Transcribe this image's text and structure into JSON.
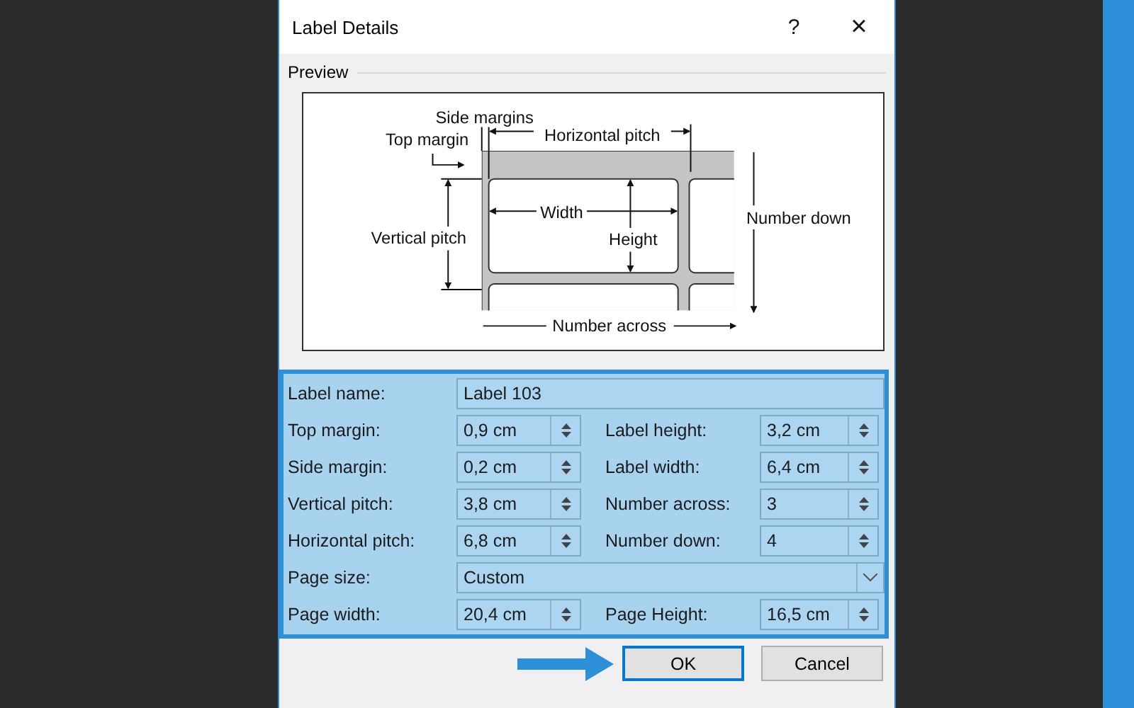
{
  "dialog": {
    "title": "Label Details",
    "help_button": "?",
    "close_button": "×"
  },
  "preview": {
    "heading": "Preview",
    "labels": [
      {
        "kind": "side_margins",
        "text": "Side margins"
      },
      {
        "kind": "top_margin",
        "text": "Top margin"
      },
      {
        "kind": "horizontal_pitch",
        "text": "Horizontal pitch"
      },
      {
        "kind": "vertical_pitch",
        "text": "Vertical pitch"
      },
      {
        "kind": "width",
        "text": "Width"
      },
      {
        "kind": "height",
        "text": "Height"
      },
      {
        "kind": "number_down",
        "text": "Number down"
      },
      {
        "kind": "number_across",
        "text": "Number across"
      }
    ]
  },
  "rows": [
    {
      "cells": [
        {
          "kind": "text",
          "label": "Label name:",
          "value": "Label 103"
        }
      ]
    },
    {
      "cells": [
        {
          "kind": "spin",
          "label": "Top margin:",
          "value": "0,9 cm"
        },
        {
          "kind": "spin",
          "label": "Label height:",
          "value": "3,2 cm"
        }
      ]
    },
    {
      "cells": [
        {
          "kind": "spin",
          "label": "Side margin:",
          "value": "0,2 cm"
        },
        {
          "kind": "spin",
          "label": "Label width:",
          "value": "6,4 cm"
        }
      ]
    },
    {
      "cells": [
        {
          "kind": "spin",
          "label": "Vertical pitch:",
          "value": "3,8 cm"
        },
        {
          "kind": "spin",
          "label": "Number across:",
          "value": "3"
        }
      ]
    },
    {
      "cells": [
        {
          "kind": "spin",
          "label": "Horizontal pitch:",
          "value": "6,8 cm"
        },
        {
          "kind": "spin",
          "label": "Number down:",
          "value": "4"
        }
      ]
    },
    {
      "cells": [
        {
          "kind": "dropdown",
          "label": "Page size:",
          "value": "Custom"
        }
      ]
    },
    {
      "cells": [
        {
          "kind": "spin",
          "label": "Page width:",
          "value": "20,4 cm"
        },
        {
          "kind": "spin",
          "label": "Page Height:",
          "value": "16,5 cm"
        }
      ]
    }
  ],
  "buttons": [
    {
      "label": "OK",
      "default": true
    },
    {
      "label": "Cancel",
      "default": false
    }
  ]
}
